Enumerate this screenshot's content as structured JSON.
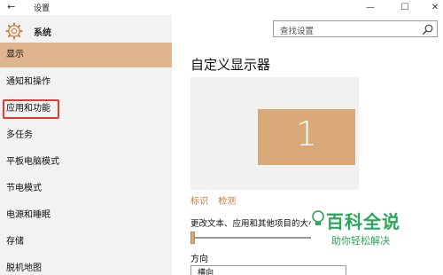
{
  "window": {
    "back_glyph": "←",
    "title": "设置",
    "minimize_glyph": "—",
    "maximize_glyph": "☐",
    "close_glyph": "✕"
  },
  "sidebar": {
    "section_title": "系统",
    "items": [
      {
        "label": "显示",
        "active": true
      },
      {
        "label": "通知和操作"
      },
      {
        "label": "应用和功能",
        "highlighted": true
      },
      {
        "label": "多任务"
      },
      {
        "label": "平板电脑模式"
      },
      {
        "label": "节电模式"
      },
      {
        "label": "电源和睡眠"
      },
      {
        "label": "存储"
      },
      {
        "label": "脱机地图"
      }
    ]
  },
  "search": {
    "placeholder": "查找设置"
  },
  "main": {
    "title": "自定义显示器",
    "monitor_number": "1",
    "links": [
      "标识",
      "检测"
    ],
    "scale_label": "更改文本、应用和其他项目的大小",
    "scale_value": 0.0,
    "orientation_label": "方向",
    "orientation_value": "横向"
  },
  "watermark": {
    "brand": "百科全说",
    "slogan": "助你轻松解决"
  },
  "colors": {
    "accent": "#d9a878",
    "active_item": "#dfb48f",
    "link": "#c07a3e",
    "highlight_box": "#e23b30",
    "watermark": "#2aa55a"
  }
}
